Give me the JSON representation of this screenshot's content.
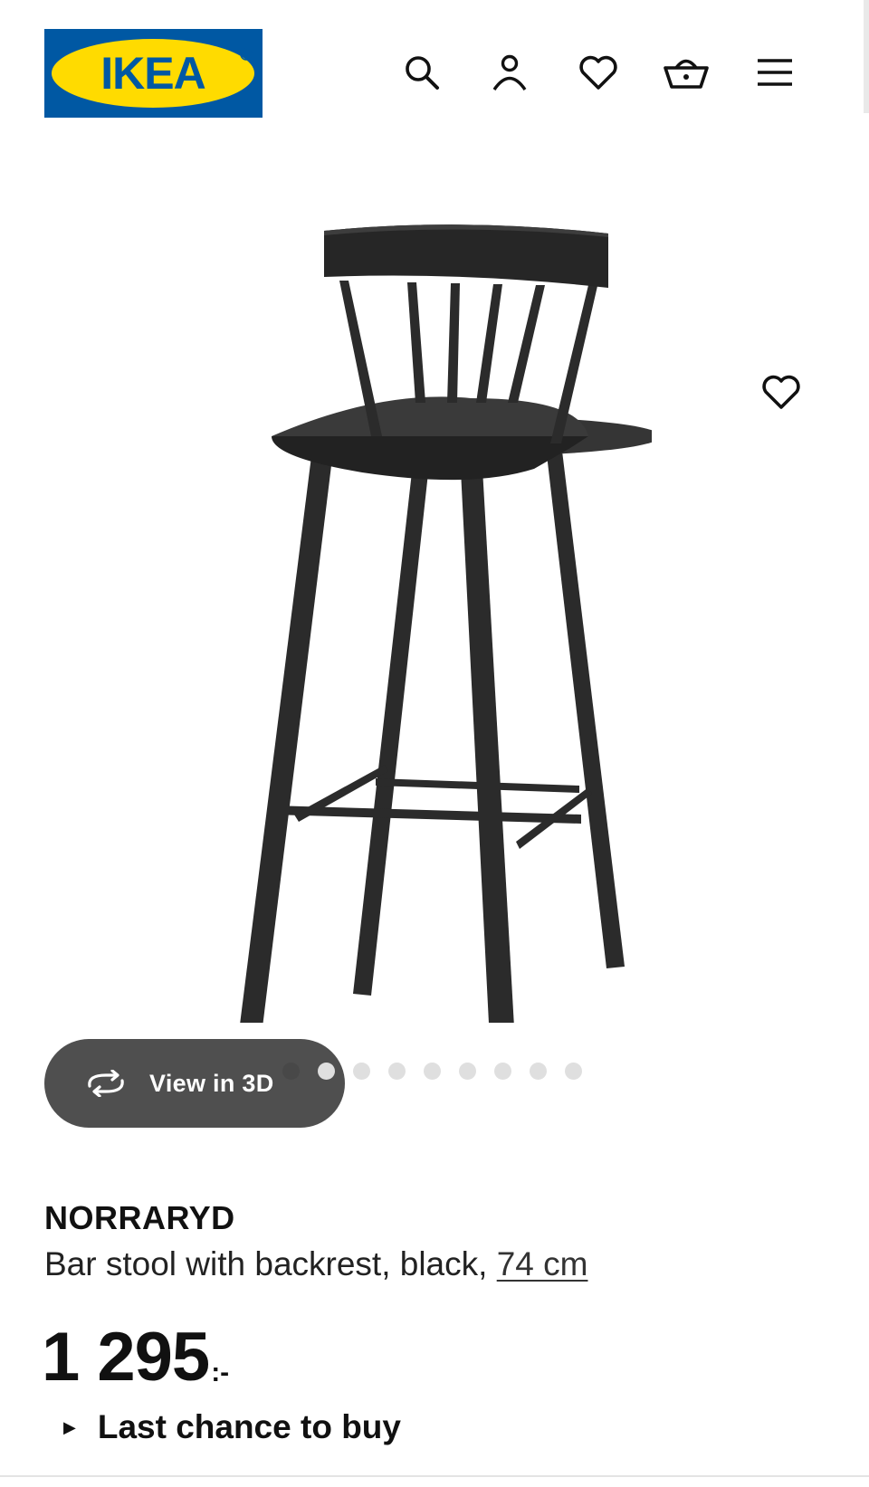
{
  "header": {
    "logo_text": "IKEA",
    "icons": [
      "search-icon",
      "account-icon",
      "favourites-icon",
      "shopping-bag-icon",
      "menu-icon"
    ]
  },
  "gallery": {
    "view_3d_label": "View in 3D",
    "image_count": 9,
    "active_index": 0
  },
  "product": {
    "name": "NORRARYD",
    "description": "Bar stool with backrest, black, ",
    "size": "74 cm",
    "price": "1 295",
    "currency": ":-",
    "availability_note": "Last chance to buy"
  },
  "colors": {
    "ikea_blue": "#0058A3",
    "ikea_yellow": "#FFDB00",
    "text": "#111111"
  }
}
